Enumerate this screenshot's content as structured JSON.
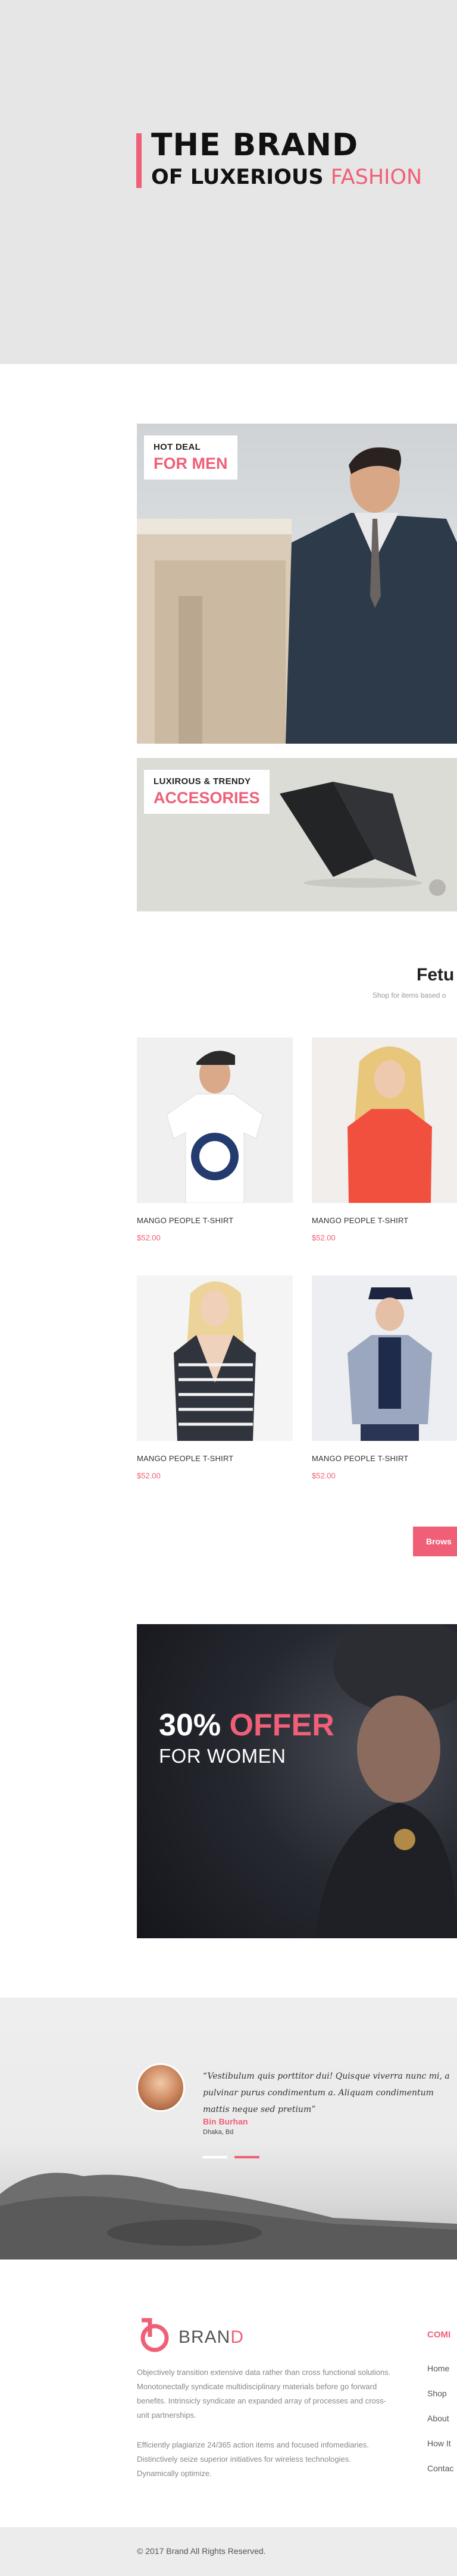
{
  "colors": {
    "accent": "#f05f78",
    "hero_bg": "#e6e6e6",
    "dark": "#111111",
    "muted": "#888888"
  },
  "hero": {
    "title_line1": "THE BRAND",
    "title_line2_prefix": "OF LUXERIOUS",
    "title_line2_accent": "FASHION"
  },
  "promos": [
    {
      "small": "HOT DEAL",
      "big": "FOR MEN"
    },
    {
      "small": "LUXIROUS & TRENDY",
      "big": "ACCESORIES"
    }
  ],
  "featured": {
    "title": "Fetu",
    "subtitle": "Shop for items based o"
  },
  "products": [
    {
      "name": "MANGO PEOPLE T-SHIRT",
      "price": "$52.00",
      "image_icon": "tshirt-man-image"
    },
    {
      "name": "MANGO PEOPLE T-SHIRT",
      "price": "$52.00",
      "image_icon": "red-top-woman-image"
    },
    {
      "name": "MANGO PEOPLE T-SHIRT",
      "price": "$52.00",
      "image_icon": "striped-top-woman-image"
    },
    {
      "name": "MANGO PEOPLE T-SHIRT",
      "price": "$52.00",
      "image_icon": "blazer-man-image"
    }
  ],
  "browse_button": "Brows",
  "offer": {
    "percent": "30%",
    "offer_word": "OFFER",
    "subtitle": "FOR WOMEN"
  },
  "testimonial": {
    "quote": "“Vestibulum quis porttitor dui! Quisque viverra nunc mi, a pulvinar purus condimentum a. Aliquam condimentum mattis neque sed pretium”",
    "author": "Bin Burhan",
    "location": "Dhaka, Bd"
  },
  "footer": {
    "logo_prefix": "BRAN",
    "logo_accent": "D",
    "about_1": "Objectively transition extensive data rather than cross functional solutions. Monotonectally syndicate multidisciplinary materials before go forward benefits. Intrinsicly syndicate an expanded array of processes and cross-unit partnerships.",
    "about_2": "Efficiently plagiarize 24/365 action items and focused infomediaries. Distinctively seize superior initiatives for wireless technologies. Dynamically optimize.",
    "column_title": "COMI",
    "links": [
      "Home",
      "Shop",
      "About",
      "How It",
      "Contac"
    ]
  },
  "copyright": "© 2017  Brand  All Rights Reserved."
}
